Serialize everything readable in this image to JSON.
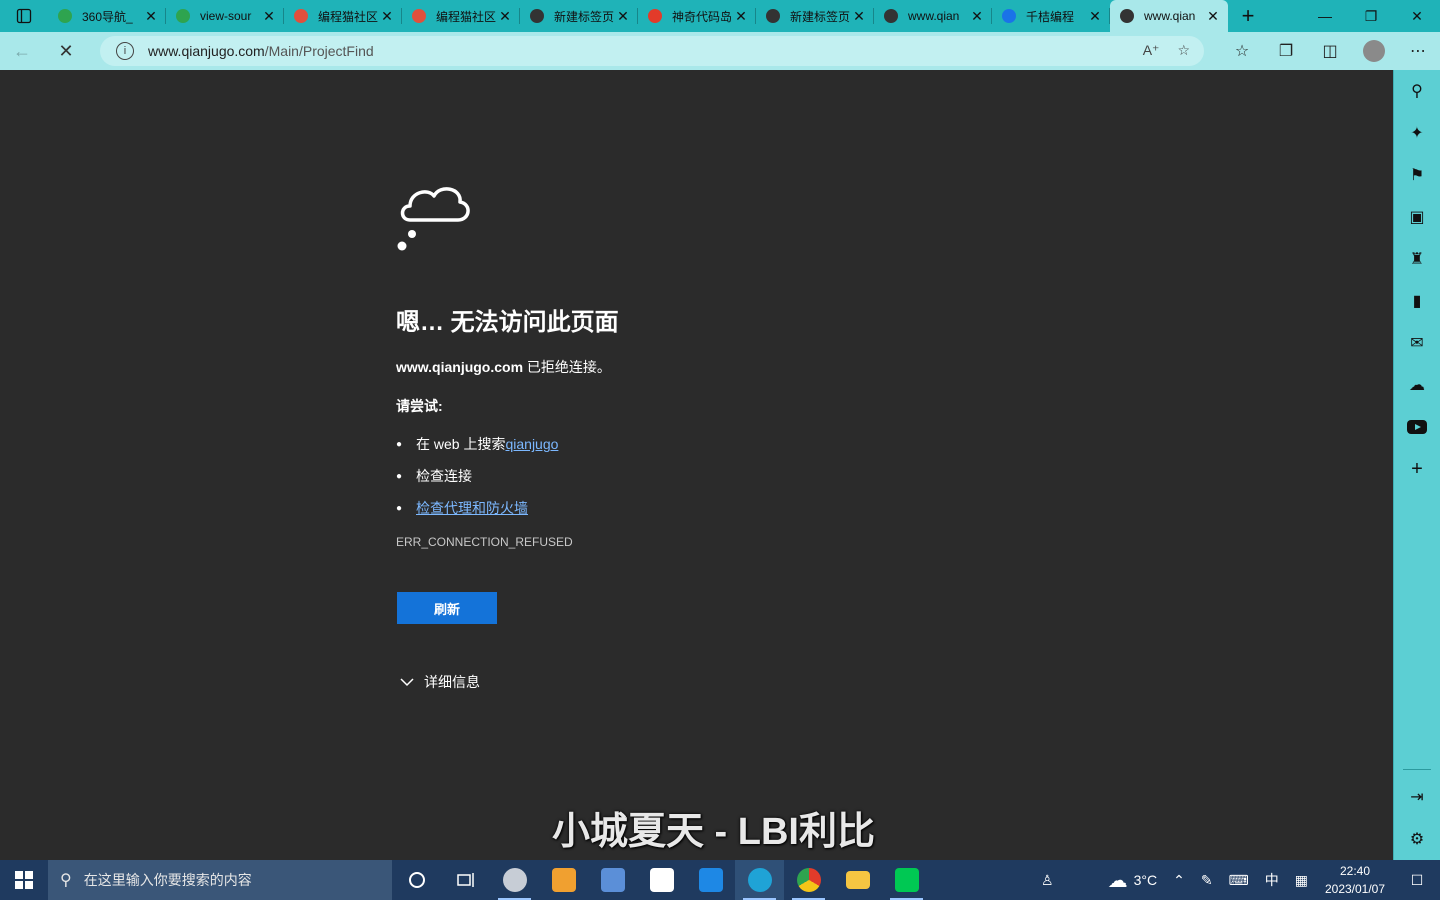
{
  "tabs": [
    {
      "title": "360导航_",
      "favicon": "360-icon",
      "color": "#2ea44f"
    },
    {
      "title": "view-sour",
      "favicon": "360-icon",
      "color": "#2ea44f"
    },
    {
      "title": "编程猫社区",
      "favicon": "codemao-icon",
      "color": "#e0503c"
    },
    {
      "title": "编程猫社区",
      "favicon": "codemao-icon",
      "color": "#e0503c"
    },
    {
      "title": "新建标签页",
      "favicon": "newtab-icon",
      "color": "#333333"
    },
    {
      "title": "神奇代码岛",
      "favicon": "shenqi-icon",
      "color": "#e23b2a"
    },
    {
      "title": "新建标签页",
      "favicon": "newtab-icon",
      "color": "#333333"
    },
    {
      "title": "www.qian",
      "favicon": "page-icon",
      "color": "#333333"
    },
    {
      "title": "千桔编程",
      "favicon": "search-icon",
      "color": "#1a73e8"
    },
    {
      "title": "www.qian",
      "favicon": "loading-icon",
      "color": "#333333",
      "active": true
    }
  ],
  "address": {
    "host": "www.qianjugo.com",
    "path": "/Main/ProjectFind"
  },
  "error": {
    "title": "嗯… 无法访问此页面",
    "host": "www.qianjugo.com",
    "refused": " 已拒绝连接。",
    "try_label": "请尝试:",
    "suggestions": {
      "search_prefix": "在 web 上搜索 ",
      "search_link": "qianjugo",
      "check_connection": "检查连接",
      "check_proxy": "检查代理和防火墙"
    },
    "code": "ERR_CONNECTION_REFUSED",
    "reload_label": "刷新",
    "details_label": "详细信息"
  },
  "lyric_overlay": "小城夏天 - LBI利比",
  "taskbar": {
    "search_placeholder": "在这里输入你要搜索的内容",
    "weather": "3°C",
    "ime": "中",
    "time": "22:40",
    "date": "2023/01/07"
  },
  "colors": {
    "accent": "#1fb3b8",
    "link": "#7cb8ff",
    "button": "#1473d9"
  }
}
